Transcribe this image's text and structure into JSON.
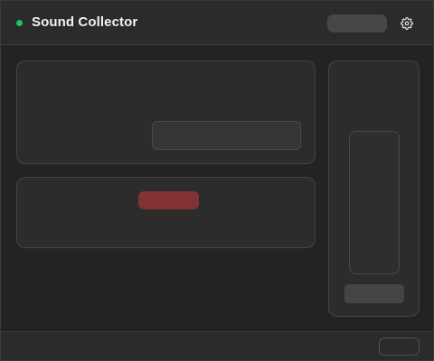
{
  "header": {
    "title": "Sound Collector",
    "status_color": "#1fbf6e",
    "settings_icon": "gear-icon"
  },
  "colors": {
    "background": "#232323",
    "panel": "#2c2c2c",
    "record_accent": "#823232"
  }
}
